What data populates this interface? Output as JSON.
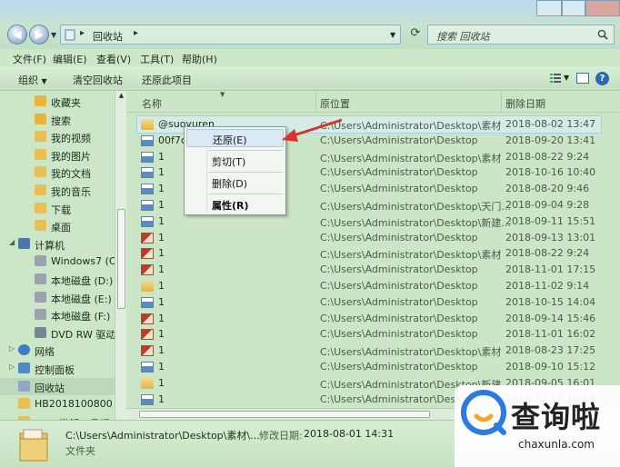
{
  "address": {
    "location": "回收站",
    "search_placeholder": "搜索 回收站"
  },
  "menu": [
    "文件(F)",
    "编辑(E)",
    "查看(V)",
    "工具(T)",
    "帮助(H)"
  ],
  "toolbar": {
    "organize": "组织",
    "empty": "清空回收站",
    "restore_all": "还原此项目"
  },
  "sidebar": [
    {
      "label": "收藏夹",
      "icon": "favorites-icon",
      "indent": 2
    },
    {
      "label": "搜索",
      "icon": "search-folder-icon",
      "indent": 2
    },
    {
      "label": "我的视频",
      "icon": "folder-icon",
      "indent": 2
    },
    {
      "label": "我的图片",
      "icon": "folder-icon",
      "indent": 2
    },
    {
      "label": "我的文档",
      "icon": "folder-icon",
      "indent": 2
    },
    {
      "label": "我的音乐",
      "icon": "folder-icon",
      "indent": 2
    },
    {
      "label": "下载",
      "icon": "folder-icon",
      "indent": 2
    },
    {
      "label": "桌面",
      "icon": "folder-icon",
      "indent": 2
    },
    {
      "label": "计算机",
      "icon": "computer-icon",
      "indent": 1
    },
    {
      "label": "Windows7 (C:",
      "icon": "drive-icon",
      "indent": 2
    },
    {
      "label": "本地磁盘 (D:)",
      "icon": "drive-icon",
      "indent": 2
    },
    {
      "label": "本地磁盘 (E:)",
      "icon": "drive-icon",
      "indent": 2
    },
    {
      "label": "本地磁盘 (F:)",
      "icon": "drive-icon",
      "indent": 2
    },
    {
      "label": "DVD RW 驱动",
      "icon": "dvd-icon",
      "indent": 2
    },
    {
      "label": "网络",
      "icon": "network-icon",
      "indent": 1
    },
    {
      "label": "控制面板",
      "icon": "control-panel-icon",
      "indent": 1
    },
    {
      "label": "回收站",
      "icon": "recycle-bin-icon",
      "indent": 1,
      "selected": true
    },
    {
      "label": "HB2018100800",
      "icon": "folder-icon",
      "indent": 1
    },
    {
      "label": "Win7激活工具吧",
      "icon": "folder-icon",
      "indent": 1
    }
  ],
  "columns": {
    "name": "名称",
    "location": "原位置",
    "deleted": "删除日期"
  },
  "files": [
    {
      "name": "@suoyuren",
      "path": "C:\\Users\\Administrator\\Desktop\\素材",
      "date": "2018-08-02 13:47",
      "icon": "folder"
    },
    {
      "name": "00f7c0",
      "path": "C:\\Users\\Administrator\\Desktop",
      "date": "2018-09-20 13:41",
      "icon": "image"
    },
    {
      "name": "1",
      "path": "C:\\Users\\Administrator\\Desktop\\素材",
      "date": "2018-08-22 9:24",
      "icon": "image"
    },
    {
      "name": "1",
      "path": "C:\\Users\\Administrator\\Desktop",
      "date": "2018-10-16 10:40",
      "icon": "image"
    },
    {
      "name": "1",
      "path": "C:\\Users\\Administrator\\Desktop",
      "date": "2018-08-20 9:46",
      "icon": "image"
    },
    {
      "name": "1",
      "path": "C:\\Users\\Administrator\\Desktop\\天门...",
      "date": "2018-09-04 9:28",
      "icon": "image"
    },
    {
      "name": "1",
      "path": "C:\\Users\\Administrator\\Desktop\\新建...",
      "date": "2018-09-11 15:51",
      "icon": "image"
    },
    {
      "name": "1",
      "path": "C:\\Users\\Administrator\\Desktop",
      "date": "2018-09-13 13:01",
      "icon": "red-image"
    },
    {
      "name": "1",
      "path": "C:\\Users\\Administrator\\Desktop\\素材",
      "date": "2018-08-22 9:24",
      "icon": "red-image"
    },
    {
      "name": "1",
      "path": "C:\\Users\\Administrator\\Desktop",
      "date": "2018-11-01 17:15",
      "icon": "red-image"
    },
    {
      "name": "1",
      "path": "C:\\Users\\Administrator\\Desktop",
      "date": "2018-11-02 9:14",
      "icon": "folder"
    },
    {
      "name": "1",
      "path": "C:\\Users\\Administrator\\Desktop",
      "date": "2018-10-15 14:04",
      "icon": "image"
    },
    {
      "name": "1",
      "path": "C:\\Users\\Administrator\\Desktop",
      "date": "2018-09-14 15:46",
      "icon": "red-image"
    },
    {
      "name": "1",
      "path": "C:\\Users\\Administrator\\Desktop",
      "date": "2018-11-01 16:02",
      "icon": "red-image"
    },
    {
      "name": "1",
      "path": "C:\\Users\\Administrator\\Desktop\\素材",
      "date": "2018-08-23 17:25",
      "icon": "red-image"
    },
    {
      "name": "1",
      "path": "C:\\Users\\Administrator\\Desktop",
      "date": "2018-09-10 15:12",
      "icon": "image"
    },
    {
      "name": "1",
      "path": "C:\\Users\\Administrator\\Desktop\\新建...",
      "date": "2018-09-05 16:01",
      "icon": "folder"
    },
    {
      "name": "1",
      "path": "C:\\Users\\Administrator\\Desktop",
      "date": "2018-10-16 10:46",
      "icon": "image"
    }
  ],
  "context_menu": [
    "还原(E)",
    "剪切(T)",
    "删除(D)",
    "属性(R)"
  ],
  "status": {
    "path": "C:\\Users\\Administrator\\Desktop\\素材\\...",
    "modified_label": "修改日期:",
    "modified_value": "2018-08-01 14:31",
    "type": "文件夹"
  },
  "watermark": {
    "cn": "查询啦",
    "en": "chaxunla.com"
  },
  "colors": {
    "background": "#cde7c9",
    "accent_blue": "#2e67b5",
    "arrow_red": "#d9322b"
  }
}
